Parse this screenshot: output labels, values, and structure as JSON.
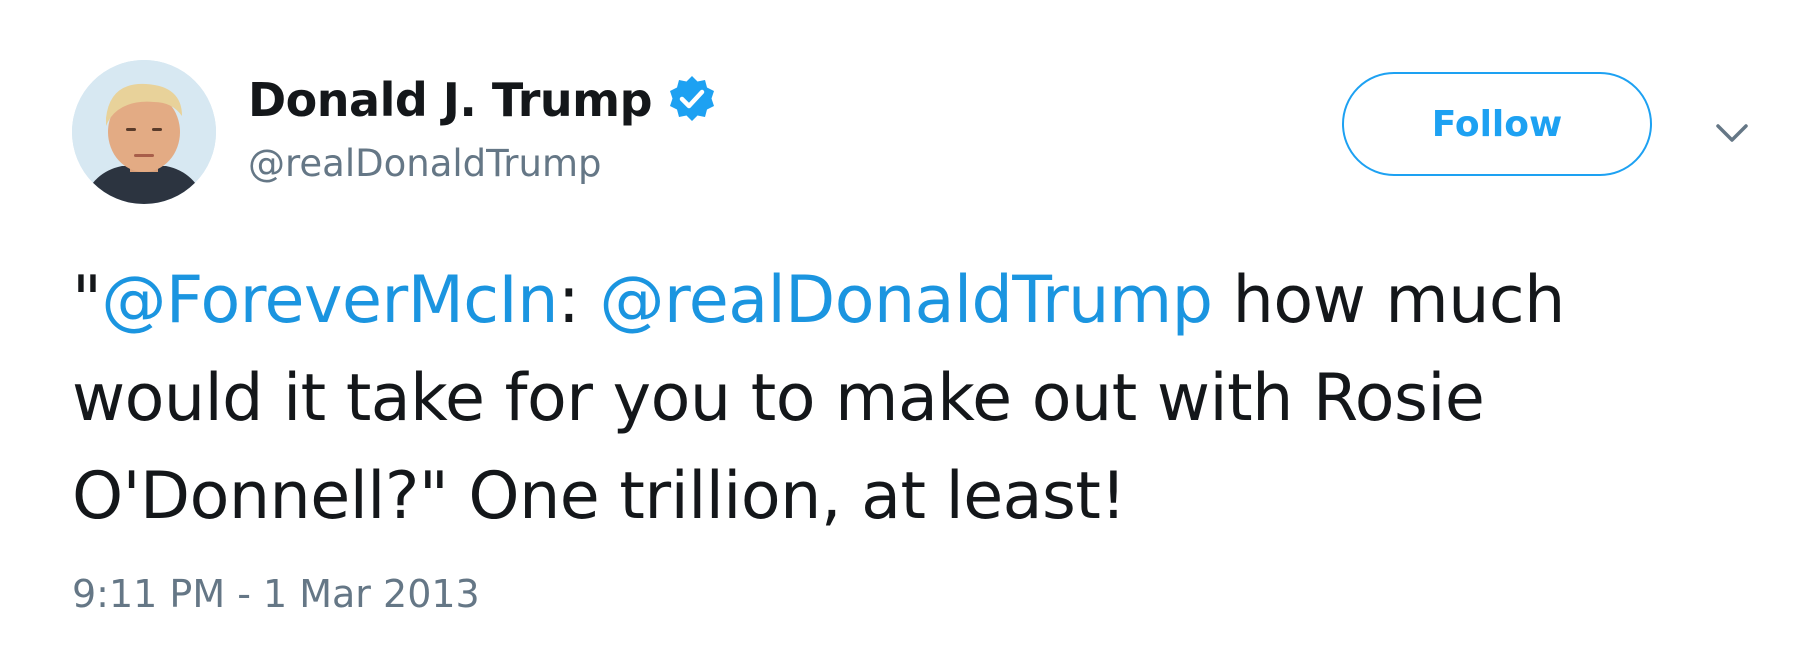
{
  "author": {
    "display_name": "Donald J. Trump",
    "handle": "@realDonaldTrump",
    "verified": true,
    "avatar_icon": "profile-photo"
  },
  "actions": {
    "follow_label": "Follow",
    "more_icon": "chevron-down-icon"
  },
  "tweet": {
    "quote_open": "\"",
    "mention_1": "@ForeverMcIn",
    "sep_1": ": ",
    "mention_2": "@realDonaldTrump",
    "text_rest": " how much would it take for you to make out with Rosie O'Donnell?\" One trillion, at least!",
    "timestamp": "9:11 PM - 1 Mar 2013"
  },
  "colors": {
    "accent": "#1da1f2",
    "link": "#1b95e0",
    "text": "#14171a",
    "muted": "#657786"
  }
}
